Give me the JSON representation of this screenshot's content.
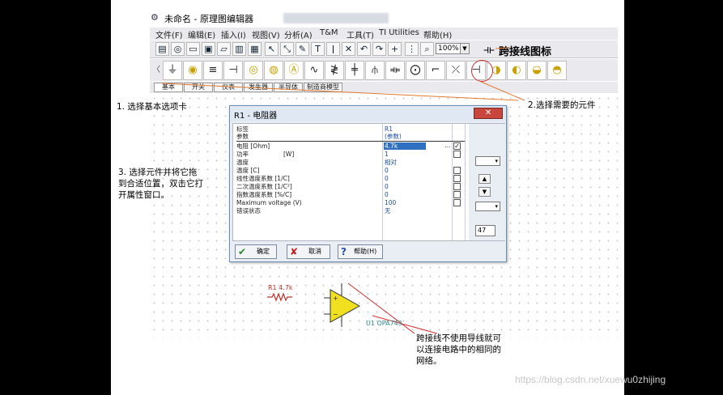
{
  "app": {
    "title": "未命名 - 原理图编辑器",
    "menu": [
      "文件(F)",
      "编辑(E)",
      "插入(I)",
      "视图(V)",
      "分析(A)",
      "T&M",
      "工具(T)",
      "TI Utilities",
      "帮助(H)"
    ],
    "zoom": "100%",
    "jumper_icon_label": "跨接线图标",
    "tabs": [
      "基本",
      "开关",
      "仪表",
      "发生器",
      "半导体",
      "制造商模型"
    ]
  },
  "dialog": {
    "title": "R1 - 电阻器",
    "close_label": "✕",
    "header_name": "标签",
    "header_value": "R1",
    "header_name2": "参数",
    "header_value2": "(参数)",
    "params": [
      {
        "name": "电阻 [Ohm]",
        "unit": "",
        "value": "4.7k"
      },
      {
        "name": "功率",
        "unit": "[W]",
        "value": "1"
      },
      {
        "name": "温度",
        "unit": "",
        "value": "相对"
      },
      {
        "name": "温度 [C]",
        "unit": "",
        "value": "0"
      },
      {
        "name": "线性温度系数 [1/C]",
        "unit": "",
        "value": "0"
      },
      {
        "name": "二次温度系数 [1/C²]",
        "unit": "",
        "value": "0"
      },
      {
        "name": "指数温度系数 [%/C]",
        "unit": "",
        "value": "0"
      },
      {
        "name": "Maximum voltage (V)",
        "unit": "",
        "value": "100"
      },
      {
        "name": "错误状态",
        "unit": "",
        "value": "无"
      }
    ],
    "dots": "...",
    "side_field": "47",
    "ok_label": "确定",
    "cancel_label": "取消",
    "help_label": "帮助(H)"
  },
  "annotations": {
    "step1": "1. 选择基本选项卡",
    "step2": "2.选择需要的元件",
    "step3_line1": "3. 选择元件并将它拖",
    "step3_line2": "到合适位置，双击它打",
    "step3_line3": "开属性窗口。",
    "jumper_note_line1": "跨接线不使用导线就可",
    "jumper_note_line2": "以连接电路中的相同的",
    "jumper_note_line3": "网络。"
  },
  "schematic": {
    "r1_label": "R1 4.7k",
    "u1_label": "U1 OPA743"
  },
  "watermark": "https://blog.csdn.net/xuewu0zhijing",
  "colors": {
    "highlight": "#3070c0",
    "annotation_line": "#e07a30",
    "circle": "#d03030",
    "resistor": "#c0302a"
  }
}
